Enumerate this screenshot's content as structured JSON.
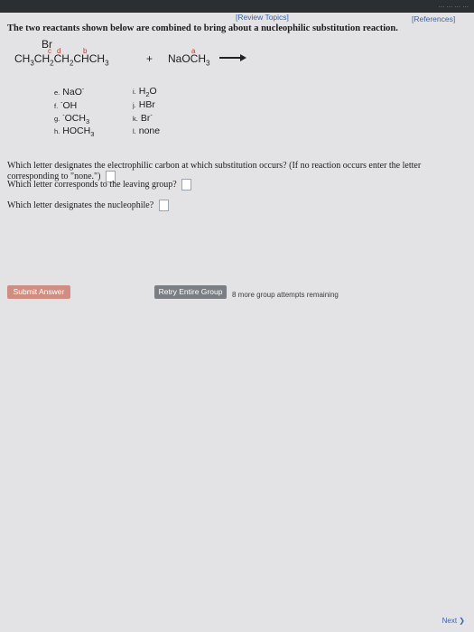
{
  "header": {
    "truncated_text": "... ... ... ...",
    "review_link": "[Review Topics]",
    "references_link": "[References]"
  },
  "question": {
    "intro": "The two reactants shown below are combined to bring about a nucleophilic substitution reaction.",
    "reactant1_top": "Br",
    "reactant1_main": "CH3CH2CH2CHCH3",
    "plus": "+",
    "reactant2": "NaOCH3",
    "labels": {
      "a": "a",
      "b": "b",
      "c": "c",
      "d": "d"
    },
    "options": [
      {
        "letter": "e.",
        "text": "NaO⁻"
      },
      {
        "letter": "f.",
        "text": "⁻OH"
      },
      {
        "letter": "g.",
        "text": "⁻OCH3"
      },
      {
        "letter": "h.",
        "text": "HOCH3"
      },
      {
        "letter": "i.",
        "text": "H2O"
      },
      {
        "letter": "j.",
        "text": "HBr"
      },
      {
        "letter": "k.",
        "text": "Br⁻"
      },
      {
        "letter": "l.",
        "text": "none"
      }
    ],
    "q1": "Which letter designates the electrophilic carbon at which substitution occurs? (If no reaction occurs enter the letter corresponding to \"none.\")",
    "q2": "Which letter corresponds to the leaving group?",
    "q3": "Which letter designates the nucleophile?"
  },
  "actions": {
    "submit": "Submit Answer",
    "retry": "Retry Entire Group",
    "remaining": "8 more group attempts remaining",
    "next": "Next"
  },
  "colors": {
    "topbar": "#2b2f33",
    "link": "#3d63a8",
    "submit": "#d08e82",
    "retry": "#7b7e82"
  }
}
